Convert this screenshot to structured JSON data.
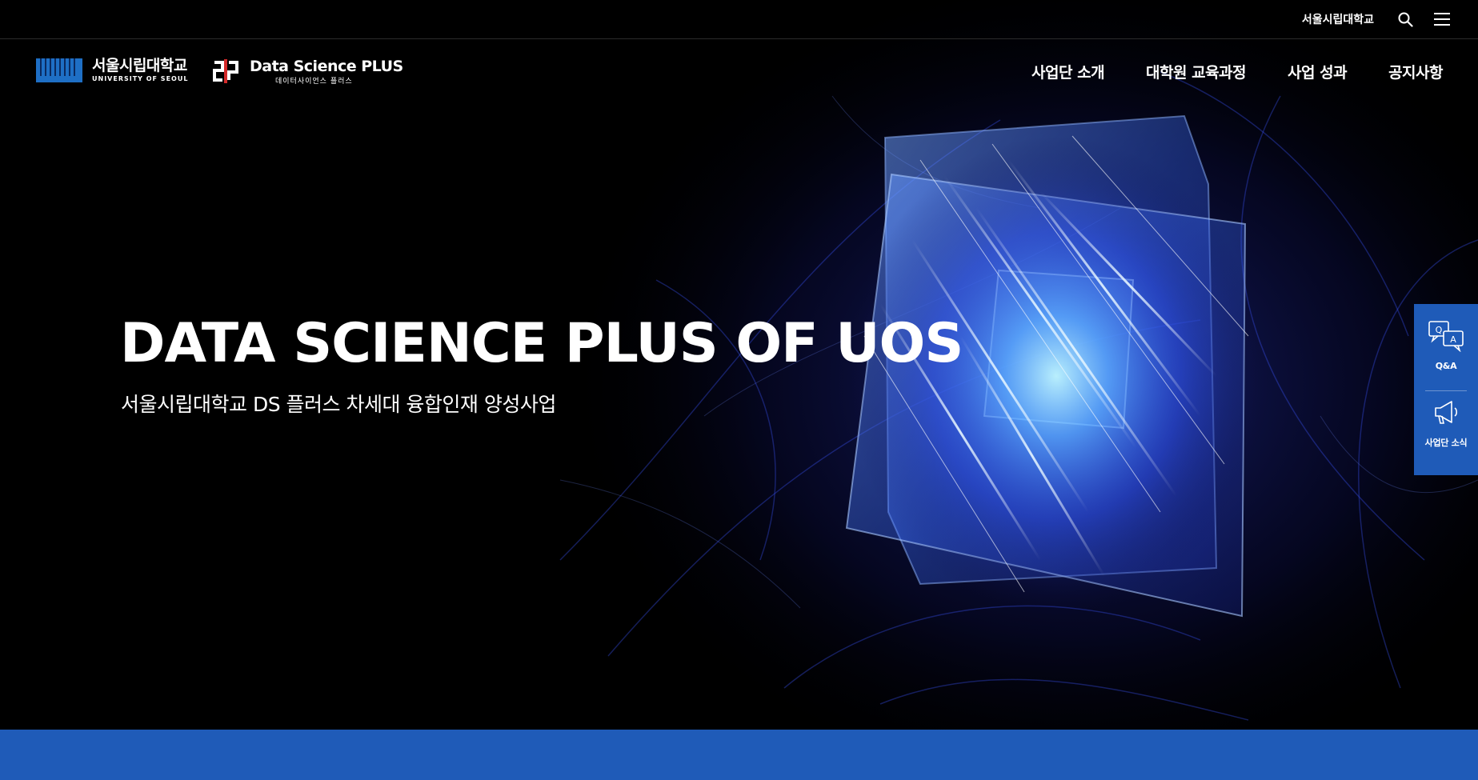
{
  "utility": {
    "university_link": "서울시립대학교",
    "search_icon": "search-icon",
    "menu_icon": "hamburger-menu-icon"
  },
  "header": {
    "uos_logo": {
      "name": "서울시립대학교",
      "sub": "UNIVERSITY OF SEOUL"
    },
    "dsp_logo": {
      "name": "Data Science PLUS",
      "sub": "데이터사이언스 플러스"
    },
    "nav": [
      {
        "label": "사업단 소개"
      },
      {
        "label": "대학원 교육과정"
      },
      {
        "label": "사업 성과"
      },
      {
        "label": "공지사항"
      }
    ]
  },
  "hero": {
    "title": "DATA SCIENCE PLUS OF UOS",
    "subtitle": "서울시립대학교 DS 플러스 차세대 융합인재 양성사업"
  },
  "quick_panel": {
    "items": [
      {
        "label": "Q&A",
        "icon": "qa-chat-icon"
      },
      {
        "label": "사업단 소식",
        "icon": "megaphone-icon"
      }
    ]
  },
  "colors": {
    "background": "#000000",
    "accent_blue": "#1f5bb8",
    "logo_red": "#d32a2a",
    "uos_blue": "#1e6fc5"
  }
}
